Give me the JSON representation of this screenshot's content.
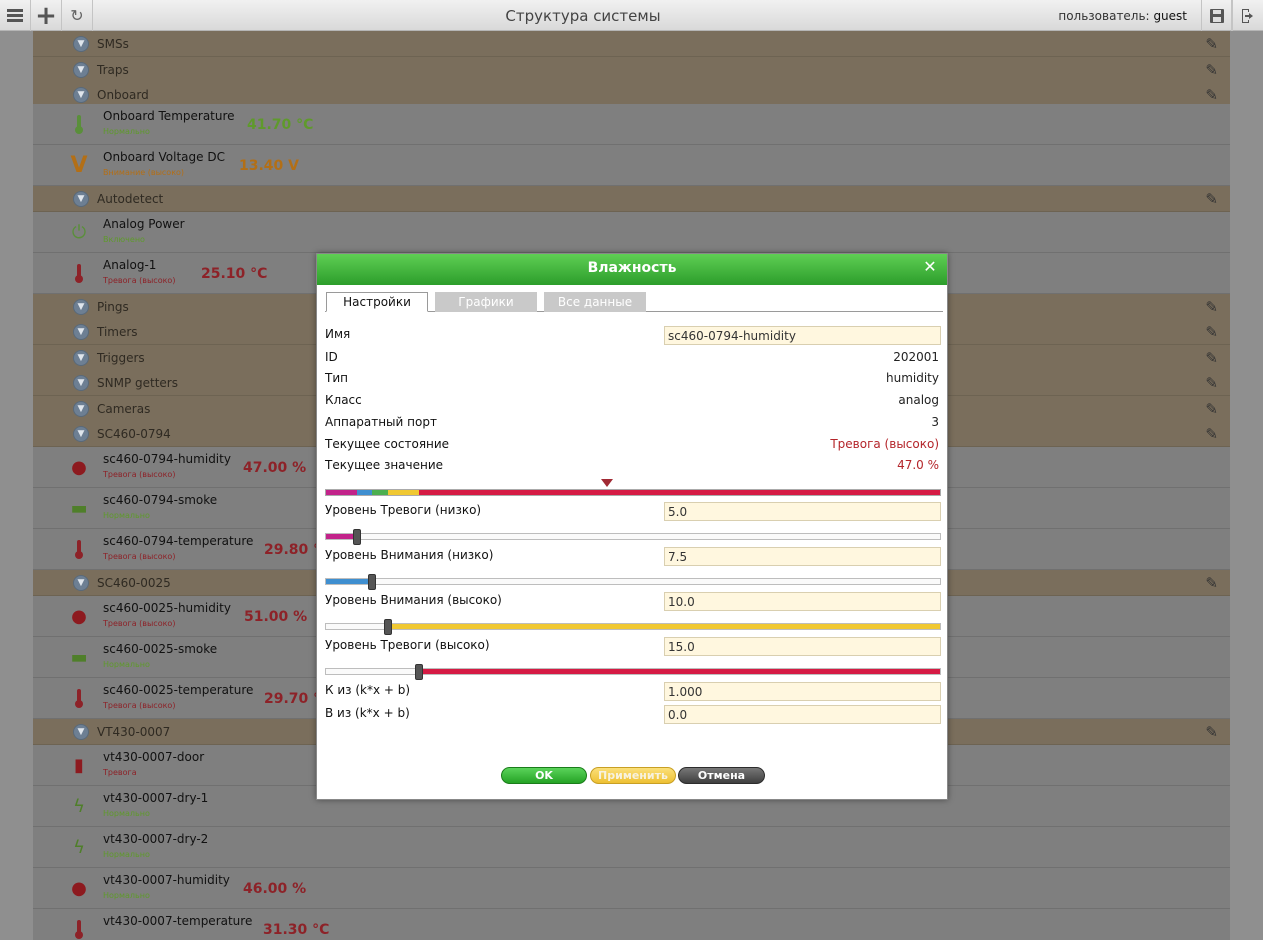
{
  "topbar": {
    "title": "Структура системы",
    "user_label": "пользователь:",
    "user_name": "guest"
  },
  "groups": [
    {
      "label": "SMSs"
    },
    {
      "label": "Traps"
    },
    {
      "label": "Onboard"
    },
    {
      "label": "Autodetect"
    },
    {
      "label": "Pings"
    },
    {
      "label": "Timers"
    },
    {
      "label": "Triggers"
    },
    {
      "label": "SNMP getters"
    },
    {
      "label": "Cameras"
    },
    {
      "label": "SC460-0794"
    },
    {
      "label": "SC460-0025"
    },
    {
      "label": "VT430-0007"
    }
  ],
  "devices": [
    {
      "name": "Onboard Temperature",
      "status": "Нормально",
      "value": "41.70 °C",
      "icon": "thermometer-icon"
    },
    {
      "name": "Onboard Voltage DC",
      "status": "Внимание (высоко)",
      "value": "13.40 V",
      "icon": "voltage-icon"
    },
    {
      "name": "Analog Power",
      "status": "Включено",
      "value": "",
      "icon": "power-icon"
    },
    {
      "name": "Analog-1",
      "status": "Тревога (высоко)",
      "value": "25.10 °C",
      "icon": "thermometer-icon"
    },
    {
      "name": "sc460-0794-humidity",
      "status": "Тревога (высоко)",
      "value": "47.00 %",
      "icon": "humidity-drop-icon"
    },
    {
      "name": "sc460-0794-smoke",
      "status": "Нормально",
      "value": "",
      "icon": "smoke-detector-icon"
    },
    {
      "name": "sc460-0794-temperature",
      "status": "Тревога (высоко)",
      "value": "29.80 °C",
      "icon": "thermometer-icon"
    },
    {
      "name": "sc460-0025-humidity",
      "status": "Тревога (высоко)",
      "value": "51.00 %",
      "icon": "humidity-drop-icon"
    },
    {
      "name": "sc460-0025-smoke",
      "status": "Нормально",
      "value": "",
      "icon": "smoke-detector-icon"
    },
    {
      "name": "sc460-0025-temperature",
      "status": "Тревога (высоко)",
      "value": "29.70 °C",
      "icon": "thermometer-icon"
    },
    {
      "name": "vt430-0007-door",
      "status": "Тревога",
      "value": "",
      "icon": "door-icon"
    },
    {
      "name": "vt430-0007-dry-1",
      "status": "Нормально",
      "value": "",
      "icon": "dry-contact-icon"
    },
    {
      "name": "vt430-0007-dry-2",
      "status": "Нормально",
      "value": "",
      "icon": "dry-contact-icon"
    },
    {
      "name": "vt430-0007-humidity",
      "status": "Нормально",
      "value": "46.00 %",
      "icon": "humidity-drop-icon"
    },
    {
      "name": "vt430-0007-temperature",
      "status": "",
      "value": "31.30 °C",
      "icon": "thermometer-icon"
    }
  ],
  "modal": {
    "title": "Влажность",
    "tabs": [
      {
        "label": "Настройки",
        "active": true
      },
      {
        "label": "Графики",
        "active": false
      },
      {
        "label": "Все данные",
        "active": false
      }
    ],
    "fields": {
      "name_label": "Имя",
      "name_value": "sc460-0794-humidity",
      "id_label": "ID",
      "id_value": "202001",
      "type_label": "Тип",
      "type_value": "humidity",
      "class_label": "Класс",
      "class_value": "analog",
      "port_label": "Аппаратный порт",
      "port_value": "3",
      "state_label": "Текущее состояние",
      "state_value": "Тревога (высоко)",
      "current_label": "Текущее значение",
      "current_value": "47.0 %",
      "alarm_low_label": "Уровень Тревоги (низко)",
      "alarm_low_value": "5.0",
      "warn_low_label": "Уровень Внимания (низко)",
      "warn_low_value": "7.5",
      "warn_high_label": "Уровень Внимания (высоко)",
      "warn_high_value": "10.0",
      "alarm_high_label": "Уровень Тревоги (высоко)",
      "alarm_high_value": "15.0",
      "k_label": "К из (k*x + b)",
      "k_value": "1.000",
      "b_label": "В из (k*x + b)",
      "b_value": "0.0"
    },
    "buttons": {
      "ok": "OK",
      "apply": "Применить",
      "cancel": "Отмена"
    }
  },
  "colors": {
    "ok_green": "#7bc043",
    "warning_orange": "#e89c2a",
    "alarm_red": "#c4252d",
    "alarm_zone": "#d51b44",
    "warn_zone_high": "#f0c832",
    "warn_zone_low": "#3f8fd0",
    "alarm_zone_low": "#c2238a",
    "normal_zone": "#4caf50",
    "header_green": "#2c9d2b",
    "group_bg": "#7a6e5c"
  }
}
